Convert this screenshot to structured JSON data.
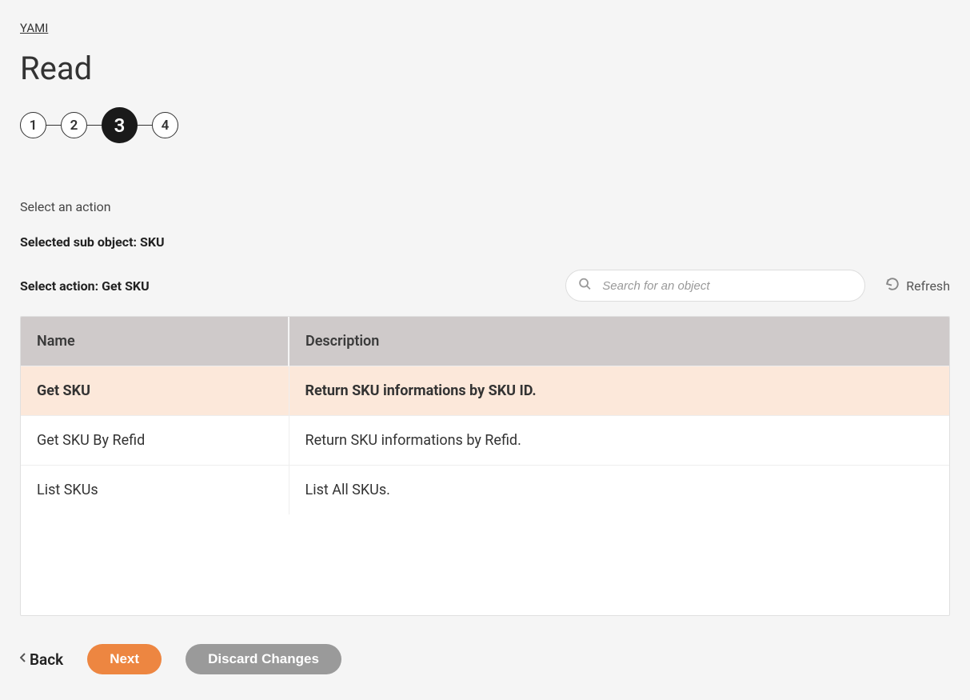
{
  "breadcrumb": {
    "label": "YAMI"
  },
  "page": {
    "title": "Read"
  },
  "stepper": {
    "steps": [
      "1",
      "2",
      "3",
      "4"
    ],
    "active_index": 2
  },
  "instructions": {
    "select_action": "Select an action",
    "selected_sub_object": "Selected sub object: SKU",
    "select_action_value": "Select action: Get SKU"
  },
  "search": {
    "placeholder": "Search for an object"
  },
  "refresh": {
    "label": "Refresh"
  },
  "table": {
    "headers": {
      "name": "Name",
      "description": "Description"
    },
    "rows": [
      {
        "name": "Get SKU",
        "description": "Return SKU informations by SKU ID.",
        "selected": true
      },
      {
        "name": "Get SKU By Refid",
        "description": "Return SKU informations by Refid.",
        "selected": false
      },
      {
        "name": "List SKUs",
        "description": "List All SKUs.",
        "selected": false
      }
    ]
  },
  "footer": {
    "back": "Back",
    "next": "Next",
    "discard": "Discard Changes"
  }
}
